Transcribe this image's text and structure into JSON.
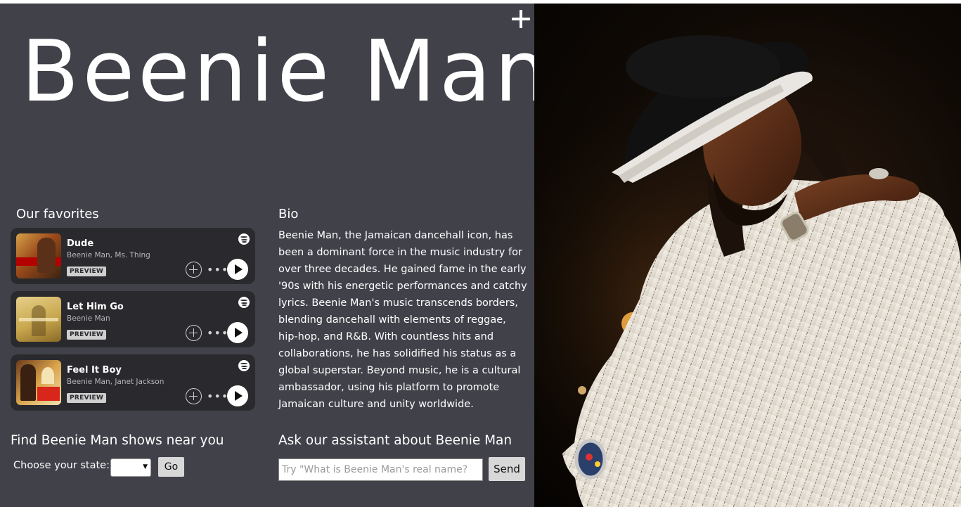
{
  "header": {
    "artist_name": "Beenie Man",
    "add_icon": "plus-icon"
  },
  "favorites": {
    "heading": "Our favorites",
    "tracks": [
      {
        "name": "Dude",
        "artists": "Beenie Man, Ms. Thing",
        "badge": "PREVIEW",
        "icons": [
          "spotify-icon",
          "add-circle-icon",
          "more-icon",
          "play-icon"
        ]
      },
      {
        "name": "Let Him Go",
        "artists": "Beenie Man",
        "badge": "PREVIEW",
        "icons": [
          "spotify-icon",
          "add-circle-icon",
          "more-icon",
          "play-icon"
        ]
      },
      {
        "name": "Feel It Boy",
        "artists": "Beenie Man, Janet Jackson",
        "badge": "PREVIEW",
        "icons": [
          "spotify-icon",
          "add-circle-icon",
          "more-icon",
          "play-icon"
        ]
      }
    ]
  },
  "bio": {
    "heading": "Bio",
    "text": "Beenie Man, the Jamaican dancehall icon, has been a dominant force in the music industry for over three decades. He gained fame in the early '90s with his energetic performances and catchy lyrics. Beenie Man's music transcends borders, blending dancehall with elements of reggae, hip-hop, and R&B. With countless hits and collaborations, he has solidified his status as a global superstar. Beyond music, he is a cultural ambassador, using his platform to promote Jamaican culture and unity worldwide."
  },
  "shows": {
    "heading": "Find Beenie Man shows near you",
    "state_label": "Choose your state:",
    "state_value": "",
    "go_label": "Go"
  },
  "assistant": {
    "heading": "Ask our assistant about Beenie Man",
    "input_value": "",
    "placeholder": "Try \"What is Beenie Man's real name?",
    "send_label": "Send"
  },
  "colors": {
    "panel_bg": "#41414a",
    "card_bg": "#2a2a2e",
    "text": "#ffffff"
  }
}
